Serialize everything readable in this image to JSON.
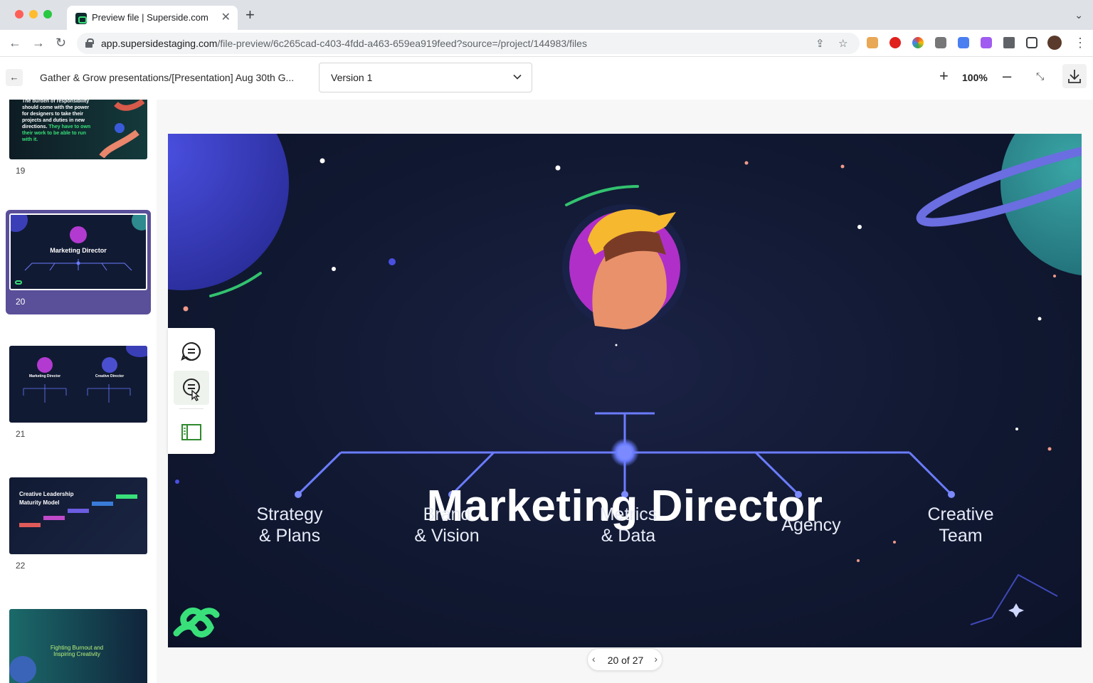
{
  "browser": {
    "tab_title": "Preview file | Superside.com",
    "url_host": "app.supersidestaging.com",
    "url_path": "/file-preview/6c265cad-c403-4fdd-a463-659ea919feed?source=/project/144983/files"
  },
  "header": {
    "breadcrumb": "Gather & Grow presentations/[Presentation] Aug 30th G...",
    "version_selected": "Version 1",
    "zoom": "100%"
  },
  "thumbnails": [
    {
      "number": "19",
      "text": "The burden of responsibility should come with the power for designers to take their projects and duties in new directions.",
      "highlight": "They have to own their work to be able to run with it."
    },
    {
      "number": "20",
      "text": "Marketing Director",
      "selected": true
    },
    {
      "number": "21",
      "text_left": "Marketing Director",
      "text_right": "Creative Director"
    },
    {
      "number": "22",
      "text": "Creative Leadership Maturity Model"
    },
    {
      "number": "",
      "text": "Fighting Burnout and Inspiring Creativity"
    }
  ],
  "slide": {
    "title": "Marketing Director",
    "branches": [
      {
        "line1": "Strategy",
        "line2": "& Plans"
      },
      {
        "line1": "Brand",
        "line2": "& Vision"
      },
      {
        "line1": "Metrics",
        "line2": "& Data"
      },
      {
        "line1": "Agency",
        "line2": ""
      },
      {
        "line1": "Creative",
        "line2": "Team"
      }
    ],
    "colors": {
      "accent": "#6b7cff",
      "logo": "#39e07a",
      "background": "#121a34"
    }
  },
  "toolbar": {
    "items": [
      "comment-icon",
      "comment-cursor-icon",
      "sidebar-panel-icon"
    ]
  },
  "pager": {
    "current": 20,
    "total": 27,
    "label": "20 of 27"
  }
}
